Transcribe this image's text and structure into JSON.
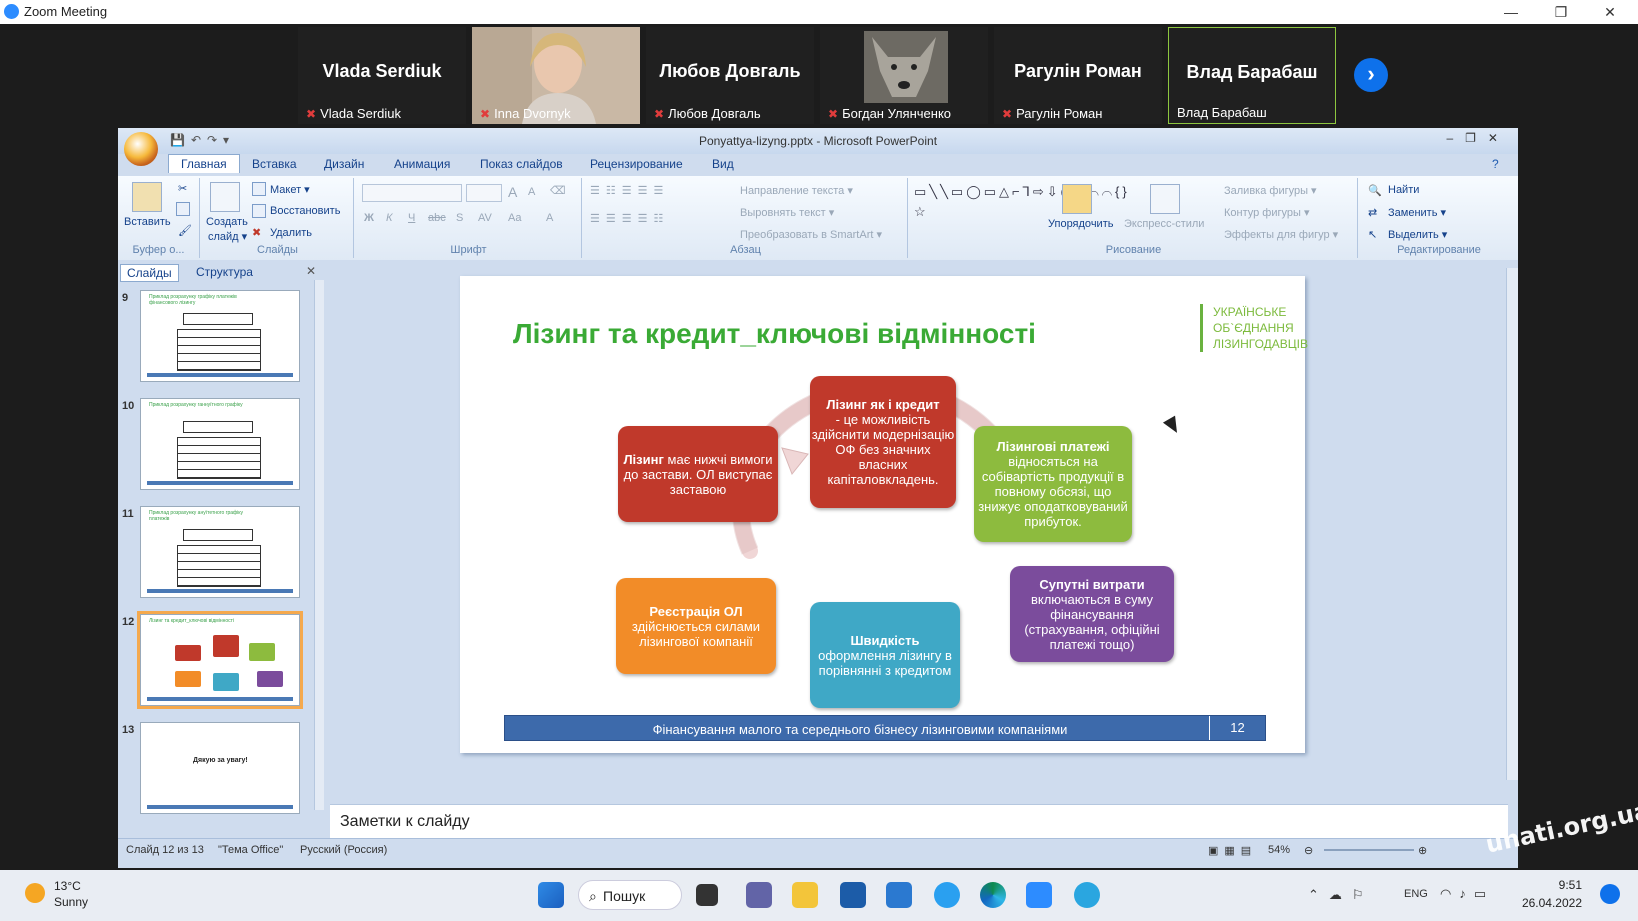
{
  "window": {
    "title": "Zoom Meeting",
    "min": "—",
    "restore": "❐",
    "close": "✕"
  },
  "participants": [
    {
      "name": "Vlada Serdiuk",
      "label": "Vlada Serdiuk",
      "muted": true,
      "video": false
    },
    {
      "name": "Inna Dvornyk",
      "label": "Inna Dvornyk",
      "muted": true,
      "video": true
    },
    {
      "name": "Любов Довгаль",
      "label": "Любов Довгаль",
      "muted": true,
      "video": false
    },
    {
      "name": "Богдан Улянченко",
      "label": "Богдан Улянченко",
      "muted": true,
      "video": true
    },
    {
      "name": "Рагулін Роман",
      "label": "Рагулін Роман",
      "muted": true,
      "video": false
    },
    {
      "name": "Влад Барабаш",
      "label": "Влад Барабаш",
      "muted": false,
      "video": false
    }
  ],
  "next_icon": "›",
  "ppt": {
    "title": "Ponyattya-lizyng.pptx - Microsoft PowerPoint",
    "tabs": [
      "Главная",
      "Вставка",
      "Дизайн",
      "Анимация",
      "Показ слайдов",
      "Рецензирование",
      "Вид"
    ],
    "ribbon": {
      "clipboard": {
        "paste": "Вставить",
        "group": "Буфер о..."
      },
      "slides": {
        "create": "Создать",
        "create2": "слайд ▾",
        "layout": "Макет ▾",
        "reset": "Восстановить",
        "delete": "Удалить",
        "group": "Слайды"
      },
      "font": {
        "group": "Шрифт",
        "bold": "Ж",
        "italic": "К",
        "underline": "Ч",
        "strike": "abc",
        "shadow": "S",
        "spacing": "AV",
        "case": "Aa",
        "grow": "A",
        "shrink": "A"
      },
      "paragraph": {
        "direction": "Направление текста ▾",
        "align": "Выровнять текст ▾",
        "smartart": "Преобразовать в SmartArt ▾",
        "group": "Абзац"
      },
      "drawing": {
        "arrange": "Упорядочить",
        "styles": "Экспресс-стили",
        "fill": "Заливка фигуры ▾",
        "outline": "Контур фигуры ▾",
        "effects": "Эффекты для фигур ▾",
        "group": "Рисование",
        "shapes": "▭╲╲▭◯▭△⌐⅂⇨⇩◯⤷⌒⌒{}☆"
      },
      "editing": {
        "find": "Найти",
        "replace": "Заменить ▾",
        "select": "Выделить ▾",
        "group": "Редактирование"
      }
    },
    "panel": {
      "tab_slides": "Слайды",
      "tab_outline": "Структура",
      "close": "✕",
      "thumbs": [
        {
          "num": "9",
          "title": "Приклад розрахунку графіку платежів фінансового лізингу"
        },
        {
          "num": "10",
          "title": "Приклад розрахунку ганнуїтного графіку"
        },
        {
          "num": "11",
          "title": "Приклад розрахунку ануїтетного графіку платежів"
        },
        {
          "num": "12",
          "title": "Лізинг та кредит_ключові відмінності"
        },
        {
          "num": "13",
          "title": "Дякую за увагу!"
        }
      ]
    },
    "slide": {
      "title": "Лізинг та кредит_ключові відмінності",
      "logo": "УКРАЇНСЬКЕ ОБ`ЄДНАННЯ ЛІЗИНГОДАВЦІВ",
      "boxes": [
        {
          "bold": "Лізинг",
          "text": "має нижчі вимоги до застави. ОЛ виступає заставою",
          "color": "#c0392b"
        },
        {
          "bold": "Лізинг як і кредит",
          "text": "- це можливість здійснити модернізацію ОФ без значних власних капіталовкладень.",
          "color": "#c0392b"
        },
        {
          "bold": "Лізингові платежі",
          "text": "відносяться на собівартість продукції в повному обсязі, що знижує оподатковуваний прибуток.",
          "color": "#8dbb3e"
        },
        {
          "bold": "Супутні витрати",
          "text": "включаються в суму фінансування (страхування, офіційні платежі тощо)",
          "color": "#7b4c9c"
        },
        {
          "bold": "Швидкість",
          "text": "оформлення лізингу в порівнянні з кредитом",
          "color": "#3fa8c6"
        },
        {
          "bold": "Реєстрація ОЛ",
          "text": "здійснюється силами лізингової компанії",
          "color": "#f28c28"
        }
      ],
      "footer": "Фінансування малого та середнього бізнесу лізинговими компаніями",
      "number": "12"
    },
    "notes": "Заметки к слайду",
    "status": {
      "slide": "Слайд 12 из 13",
      "theme": "\"Тема Office\"",
      "lang": "Русский (Россия)",
      "zoom": "54%"
    }
  },
  "taskbar": {
    "temp": "13°C",
    "weather": "Sunny",
    "search": "Пошук",
    "time": "9:51",
    "date": "26.04.2022",
    "lang": "ENG"
  },
  "watermark": "unati.org.ua"
}
